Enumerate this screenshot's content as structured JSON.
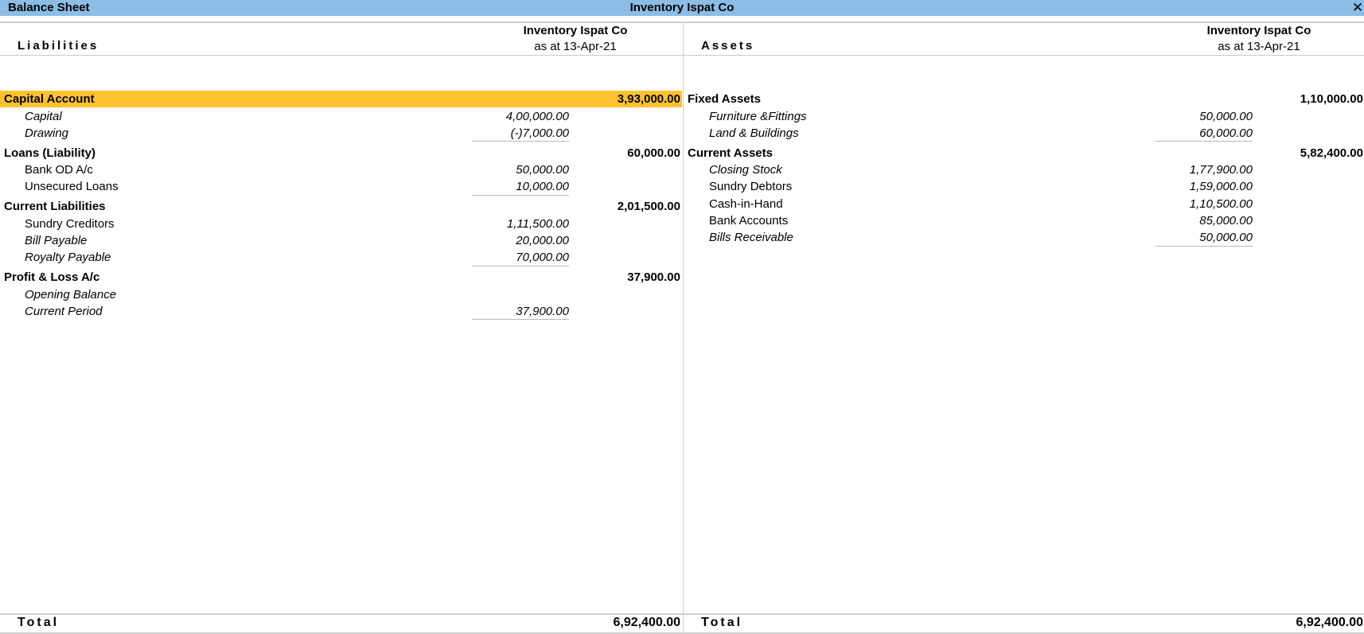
{
  "window": {
    "title": "Balance Sheet",
    "company": "Inventory Ispat Co",
    "close_glyph": "✕"
  },
  "liabilities": {
    "label": "Liabilities",
    "column_header": {
      "company": "Inventory Ispat Co",
      "date": "as at 13-Apr-21"
    },
    "groups": [
      {
        "name": "Capital Account",
        "amount": "3,93,000.00",
        "selected": true,
        "items": [
          {
            "name": "Capital",
            "amount": "4,00,000.00",
            "italic": true
          },
          {
            "name": "Drawing",
            "amount": "(-)7,000.00",
            "italic": true
          }
        ]
      },
      {
        "name": "Loans (Liability)",
        "amount": "60,000.00",
        "items": [
          {
            "name": "Bank OD A/c",
            "amount": "50,000.00",
            "italic": false
          },
          {
            "name": "Unsecured Loans",
            "amount": "10,000.00",
            "italic": false
          }
        ]
      },
      {
        "name": "Current Liabilities",
        "amount": "2,01,500.00",
        "items": [
          {
            "name": "Sundry Creditors",
            "amount": "1,11,500.00",
            "italic": false
          },
          {
            "name": "Bill Payable",
            "amount": "20,000.00",
            "italic": true
          },
          {
            "name": "Royalty Payable",
            "amount": "70,000.00",
            "italic": true
          }
        ]
      },
      {
        "name": "Profit & Loss A/c",
        "amount": "37,900.00",
        "items": [
          {
            "name": "Opening Balance",
            "amount": "",
            "italic": true
          },
          {
            "name": "Current Period",
            "amount": "37,900.00",
            "italic": true
          }
        ]
      }
    ],
    "total_label": "Total",
    "total": "6,92,400.00"
  },
  "assets": {
    "label": "Assets",
    "column_header": {
      "company": "Inventory Ispat Co",
      "date": "as at 13-Apr-21"
    },
    "groups": [
      {
        "name": "Fixed Assets",
        "amount": "1,10,000.00",
        "items": [
          {
            "name": "Furniture &Fittings",
            "amount": "50,000.00",
            "italic": true
          },
          {
            "name": "Land & Buildings",
            "amount": "60,000.00",
            "italic": true
          }
        ]
      },
      {
        "name": "Current Assets",
        "amount": "5,82,400.00",
        "items": [
          {
            "name": "Closing Stock",
            "amount": "1,77,900.00",
            "italic": true
          },
          {
            "name": "Sundry Debtors",
            "amount": "1,59,000.00",
            "italic": false
          },
          {
            "name": "Cash-in-Hand",
            "amount": "1,10,500.00",
            "italic": false
          },
          {
            "name": "Bank Accounts",
            "amount": "85,000.00",
            "italic": false
          },
          {
            "name": "Bills Receivable",
            "amount": "50,000.00",
            "italic": true
          }
        ]
      }
    ],
    "total_label": "Total",
    "total": "6,92,400.00"
  },
  "colors": {
    "titlebar": "#8BBDE5",
    "selected_row": "#FEC22E"
  }
}
